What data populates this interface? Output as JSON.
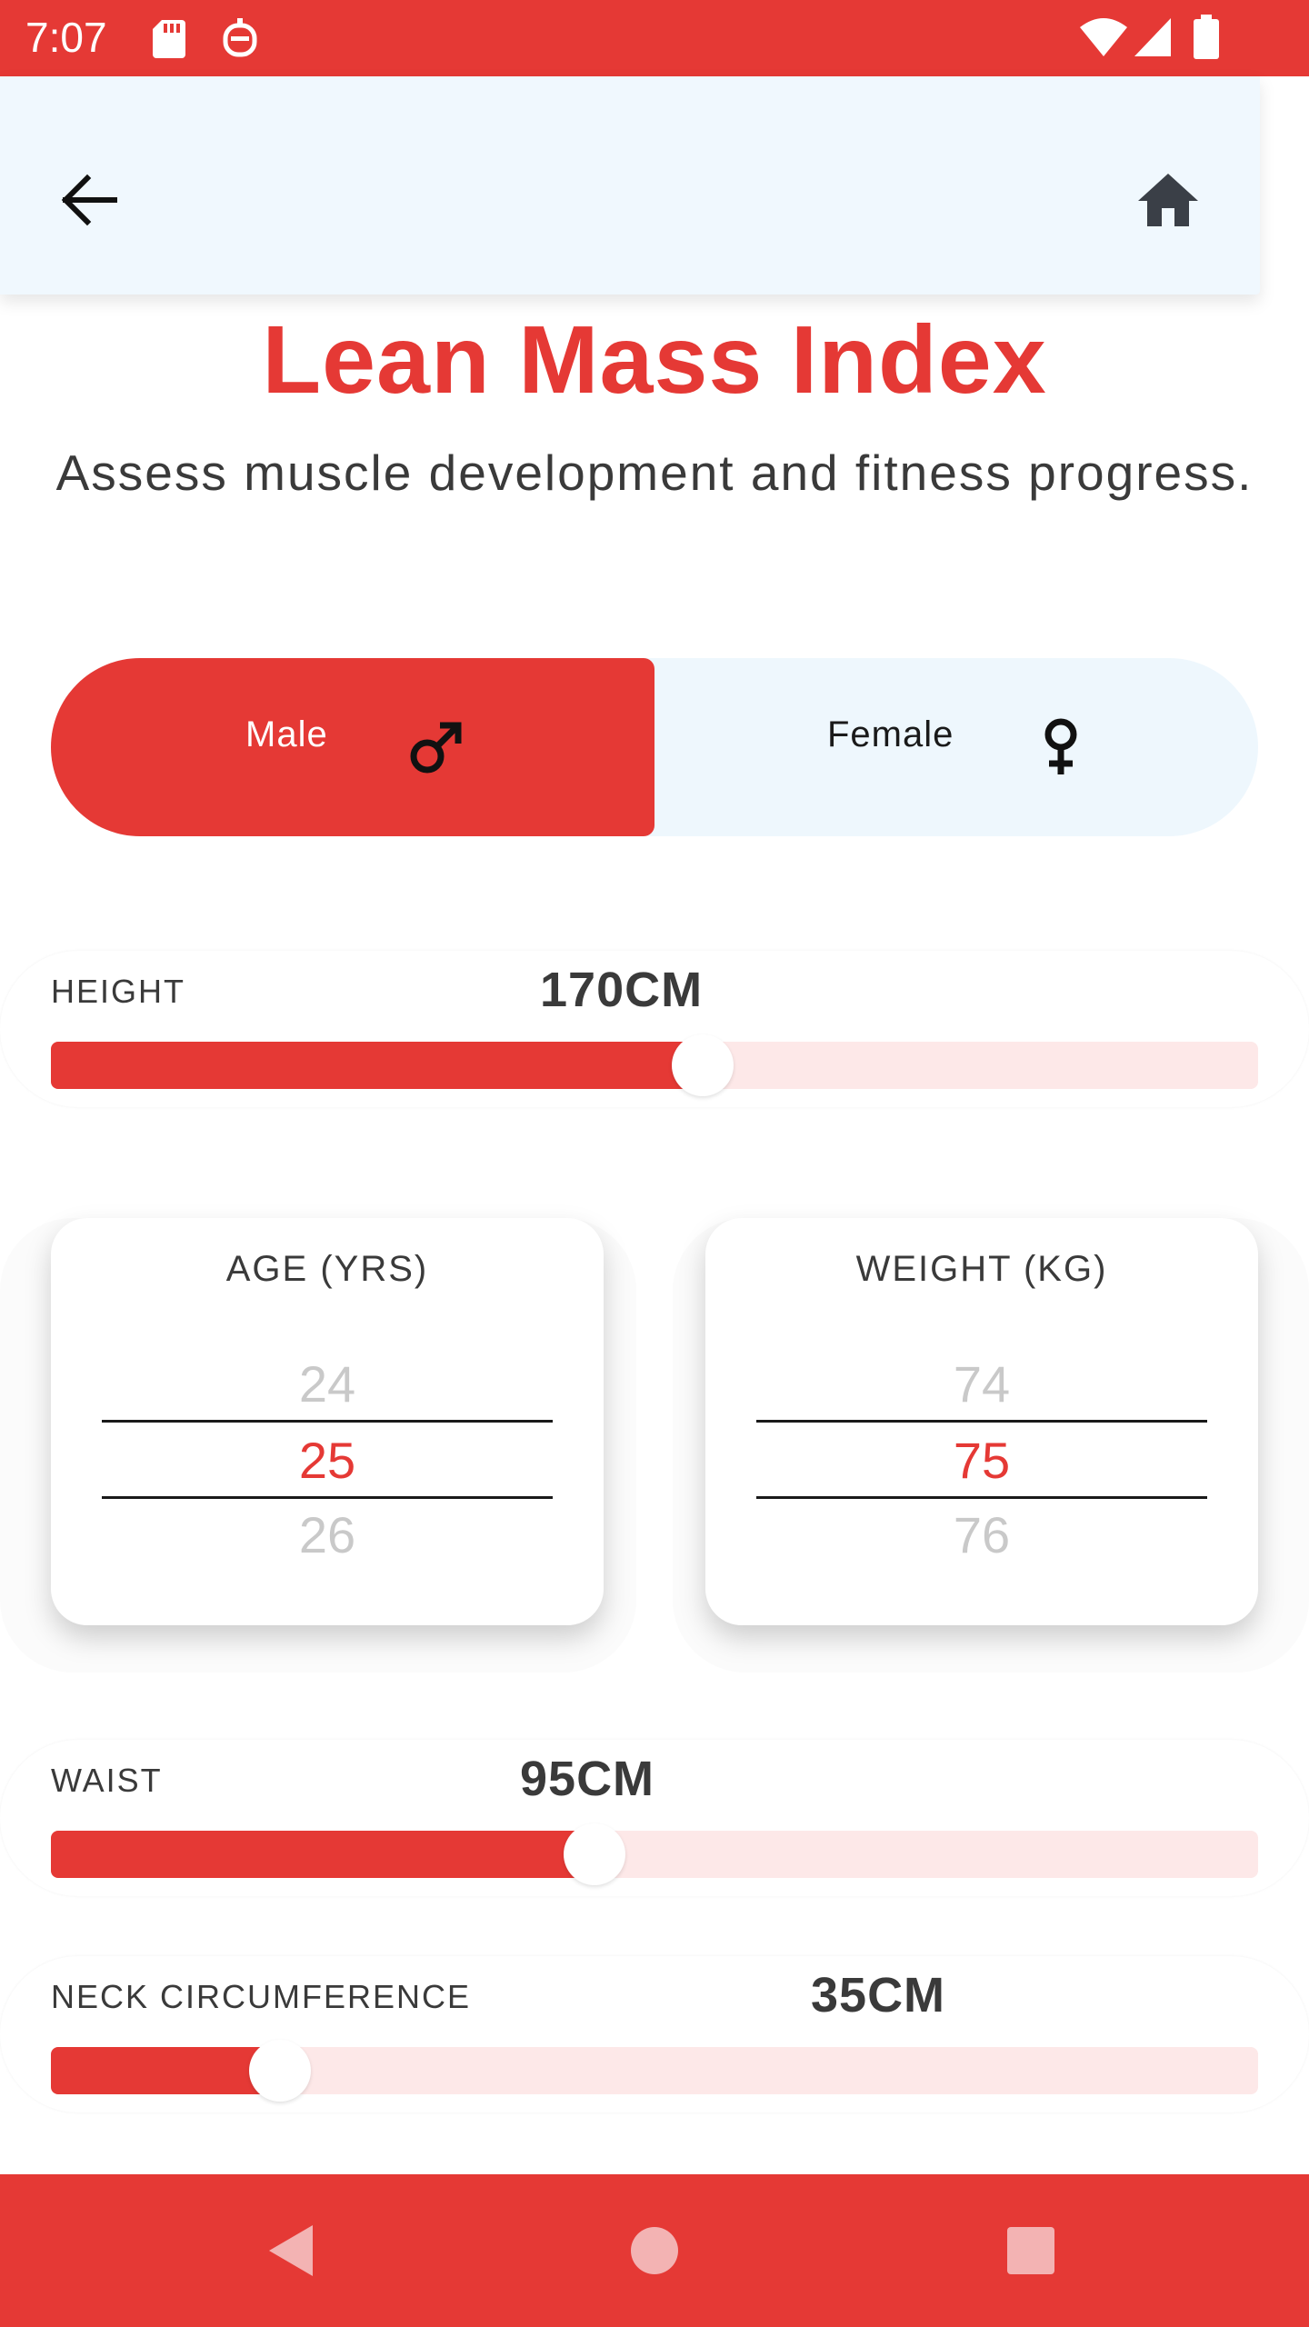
{
  "status_bar": {
    "time": "7:07",
    "icons": [
      "sd-card-icon",
      "assistant-icon",
      "wifi-icon",
      "signal-icon",
      "battery-icon"
    ]
  },
  "app_bar": {
    "back_icon": "arrow-left-icon",
    "home_icon": "home-icon"
  },
  "page": {
    "title": "Lean Mass Index",
    "subtitle": "Assess muscle development and fitness progress."
  },
  "gender": {
    "male_label": "Male",
    "female_label": "Female",
    "selected": "Male"
  },
  "height": {
    "label": "HEIGHT",
    "value": "170CM",
    "fill_fraction": 0.54
  },
  "age": {
    "title": "AGE (YRS)",
    "prev": "24",
    "selected": "25",
    "next": "26"
  },
  "weight": {
    "title": "WEIGHT (KG)",
    "prev": "74",
    "selected": "75",
    "next": "76"
  },
  "waist": {
    "label": "WAIST",
    "value": "95CM",
    "fill_fraction": 0.45
  },
  "neck": {
    "label": "NECK CIRCUMFERENCE",
    "value": "35CM",
    "fill_fraction": 0.19
  },
  "colors": {
    "accent": "#e53935",
    "track": "#fde8e8",
    "app_bar": "#f0f8fe"
  },
  "nav_bar": {
    "icons": [
      "nav-back-icon",
      "nav-home-icon",
      "nav-recents-icon"
    ]
  }
}
